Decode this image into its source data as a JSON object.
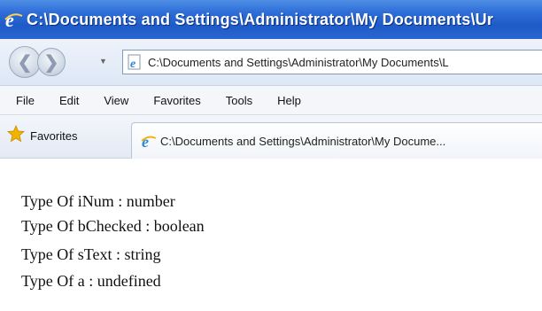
{
  "window": {
    "title": "C:\\Documents and Settings\\Administrator\\My Documents\\Ur"
  },
  "address_bar": {
    "value": "C:\\Documents and Settings\\Administrator\\My Documents\\L"
  },
  "menu": {
    "items": [
      "File",
      "Edit",
      "View",
      "Favorites",
      "Tools",
      "Help"
    ]
  },
  "favorites_bar": {
    "favorites_label": "Favorites",
    "tab_title": "C:\\Documents and Settings\\Administrator\\My Docume..."
  },
  "content": {
    "lines": [
      "Type Of iNum : number",
      "Type Of bChecked : boolean",
      "Type Of sText : string",
      "Type Of a : undefined"
    ]
  },
  "icons": {
    "title": "ie-logo-icon",
    "address": "ie-page-icon",
    "favorites": "star-icon",
    "tab": "ie-logo-icon",
    "back": "back-arrow-icon",
    "forward": "forward-arrow-icon"
  },
  "colors": {
    "titlebar": "#2a66d2",
    "title_text": "#ffffff",
    "star": "#f0b400",
    "ie_logo": "#3aa0e8"
  }
}
